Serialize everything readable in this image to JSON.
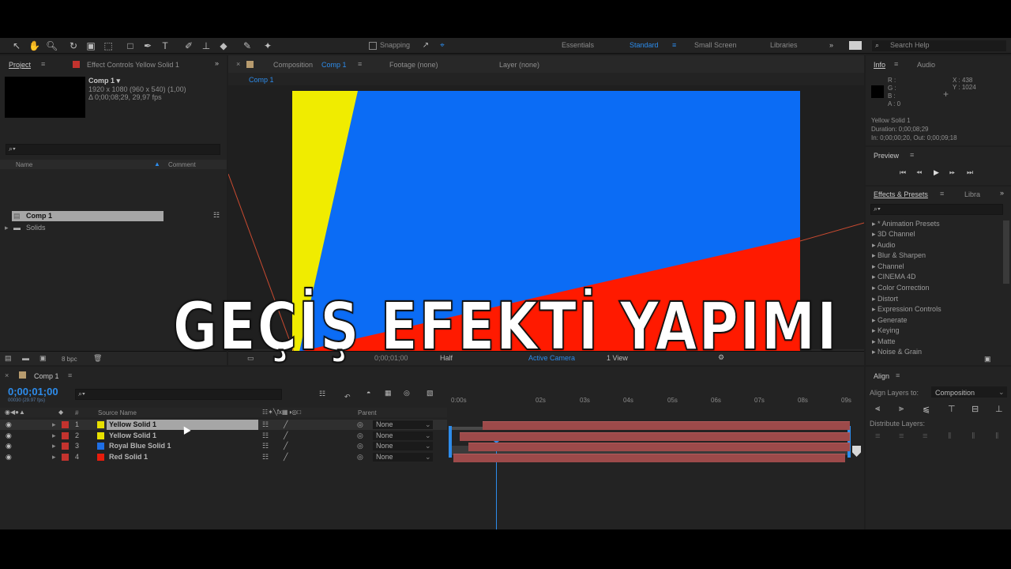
{
  "toolbar": {
    "snapping": "Snapping",
    "workspaces": [
      "Essentials",
      "Standard",
      "Small Screen",
      "Libraries"
    ],
    "search_help": "Search Help"
  },
  "project": {
    "tab": "Project",
    "effect_controls": "Effect Controls Yellow Solid 1",
    "comp_name": "Comp 1 ▾",
    "comp_size": "1920 x 1080  (960 x 540) (1,00)",
    "comp_duration": "Δ 0;00;08;29, 29,97 fps",
    "col_name": "Name",
    "col_comment": "Comment",
    "items": [
      "Comp 1",
      "Solids"
    ],
    "bpc": "8 bpc"
  },
  "composition": {
    "tab_prefix": "Composition",
    "tab_name": "Comp 1",
    "footage": "Footage (none)",
    "layer": "Layer (none)",
    "breadcrumb": "Comp 1",
    "timecode": "0;00;01;00",
    "resolution": "Half",
    "camera": "Active Camera",
    "views": "1 View"
  },
  "info": {
    "tab": "Info",
    "audio": "Audio",
    "r": "R :",
    "g": "G :",
    "b": "B :",
    "a": "A : 0",
    "x": "X : 438",
    "y": "Y : 1024",
    "layer_name": "Yellow Solid 1",
    "duration": "Duration: 0;00;08;29",
    "inout": "In: 0;00;00;20, Out: 0;00;09;18"
  },
  "preview": {
    "tab": "Preview"
  },
  "effects": {
    "tab": "Effects & Presets",
    "libra": "Libra",
    "items": [
      "* Animation Presets",
      "3D Channel",
      "Audio",
      "Blur & Sharpen",
      "Channel",
      "CINEMA 4D",
      "Color Correction",
      "Distort",
      "Expression Controls",
      "Generate",
      "Keying",
      "Matte",
      "Noise & Grain"
    ]
  },
  "align": {
    "tab": "Align",
    "align_to_label": "Align Layers to:",
    "align_to_value": "Composition",
    "distribute": "Distribute Layers:"
  },
  "timeline": {
    "tab": "Comp 1",
    "timecode": "0;00;01;00",
    "frames": "00030 (29.97 fps)",
    "col_source": "Source Name",
    "col_parent": "Parent",
    "col_num": "#",
    "ticks": [
      "0:00s",
      "02s",
      "03s",
      "04s",
      "05s",
      "06s",
      "07s",
      "08s",
      "09s"
    ],
    "layers": [
      {
        "num": "1",
        "name": "Yellow Solid 1",
        "color": "#e8e000",
        "parent": "None"
      },
      {
        "num": "2",
        "name": "Yellow Solid 1",
        "color": "#e8e000",
        "parent": "None"
      },
      {
        "num": "3",
        "name": "Royal Blue Solid 1",
        "color": "#1f6fe6",
        "parent": "None"
      },
      {
        "num": "4",
        "name": "Red Solid 1",
        "color": "#e81c0c",
        "parent": "None"
      }
    ]
  },
  "overlay": {
    "headline": "GEÇİŞ EFEKTİ YAPIMI"
  },
  "colors": {
    "accent": "#2d8ceb",
    "yellow": "#f0ec00",
    "blue": "#0b6cf5",
    "red": "#ff1a00",
    "panel": "#232323"
  }
}
